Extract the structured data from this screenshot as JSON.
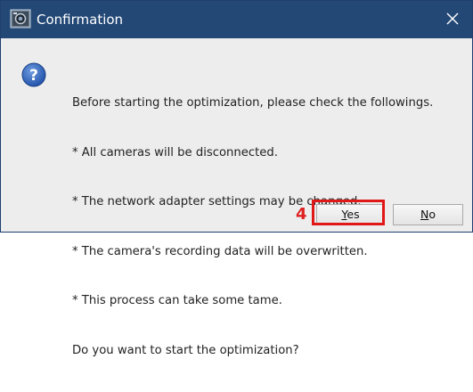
{
  "window": {
    "title": "Confirmation",
    "app_icon": "camera-app-icon",
    "close_icon": "close-icon"
  },
  "message": {
    "icon": "question-icon",
    "lines": [
      "Before starting the optimization, please check the followings.",
      "* All cameras will be disconnected.",
      "* The network adapter settings may be changed.",
      "* The camera's recording data will be overwritten.",
      "* This process can take some tame.",
      "Do you want to start the optimization?"
    ]
  },
  "annotation": {
    "step_number": "4",
    "color": "#e01818"
  },
  "buttons": {
    "yes": {
      "accel": "Y",
      "rest": "es"
    },
    "no": {
      "accel": "N",
      "rest": "o"
    }
  },
  "colors": {
    "titlebar": "#234876",
    "background": "#ededed"
  }
}
